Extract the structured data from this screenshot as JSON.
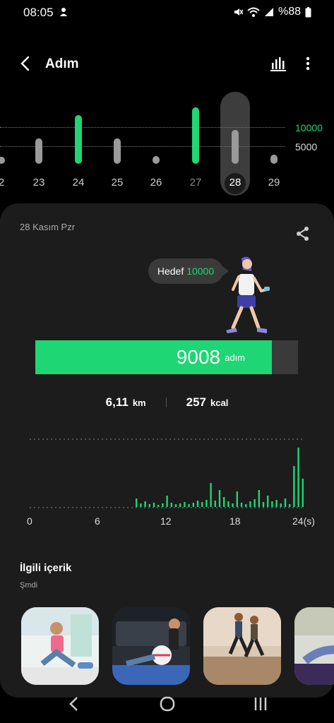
{
  "status_bar": {
    "time": "08:05",
    "battery": "%88"
  },
  "header": {
    "title": "Adım"
  },
  "week": {
    "days": [
      "2",
      "23",
      "24",
      "25",
      "26",
      "27",
      "28",
      "29"
    ],
    "selected_day": "28",
    "goal_label": "10000",
    "half_label": "5000"
  },
  "card": {
    "date": "28 Kasım Pzr",
    "goal_prefix": "Hedef",
    "goal_value": "10000",
    "steps": "9008",
    "steps_unit": "adım",
    "steps_progress": 0.9008,
    "distance": "6,11",
    "distance_unit": "km",
    "calories": "257",
    "calories_unit": "kcal",
    "hour_labels": [
      "0",
      "6",
      "12",
      "18",
      "24(s)"
    ]
  },
  "related": {
    "title": "İlgili içerik",
    "subtitle": "Şmdi"
  },
  "colors": {
    "accent": "#1ed673",
    "bar_gray": "#9a9a9a",
    "card": "#1c1c1c"
  }
}
